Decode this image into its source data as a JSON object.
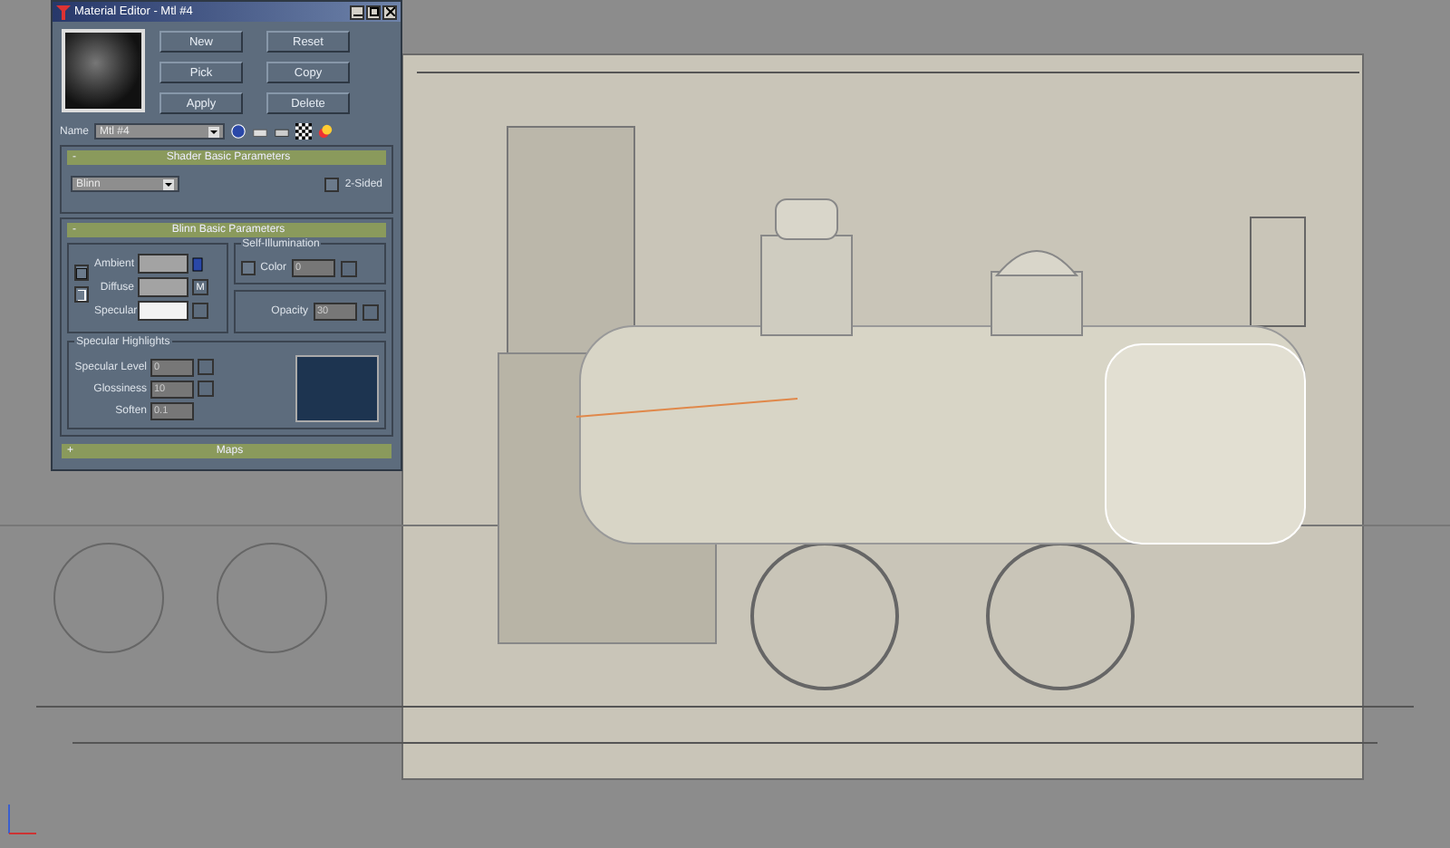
{
  "window": {
    "title": "Material Editor - Mtl #4"
  },
  "buttons": [
    "New",
    "Reset",
    "Pick",
    "Copy",
    "Apply",
    "Delete"
  ],
  "name_field": {
    "label": "Name",
    "value": "Mtl #4"
  },
  "shader_rollout": {
    "sign": "-",
    "title": "Shader Basic Parameters",
    "shader": "Blinn",
    "two_sided": {
      "label": "2-Sided",
      "checked": false
    }
  },
  "blinn_rollout": {
    "sign": "-",
    "title": "Blinn Basic Parameters",
    "colors": [
      {
        "label": "Ambient",
        "color": "#a3a3a3"
      },
      {
        "label": "Diffuse",
        "color": "#a3a3a3"
      },
      {
        "label": "Specular",
        "color": "#f2f2f2"
      }
    ],
    "map_button": "M",
    "self_illumination": {
      "title": "Self-Illumination",
      "label": "Color",
      "checked": false,
      "value": "0"
    },
    "opacity": {
      "label": "Opacity",
      "value": "30"
    },
    "specular_highlights": {
      "title": "Specular Highlights",
      "fields": [
        {
          "label": "Specular Level",
          "value": "0"
        },
        {
          "label": "Glossiness",
          "value": "10"
        },
        {
          "label": "Soften",
          "value": "0.1"
        }
      ]
    }
  },
  "maps_rollout": {
    "sign": "+",
    "title": "Maps"
  }
}
